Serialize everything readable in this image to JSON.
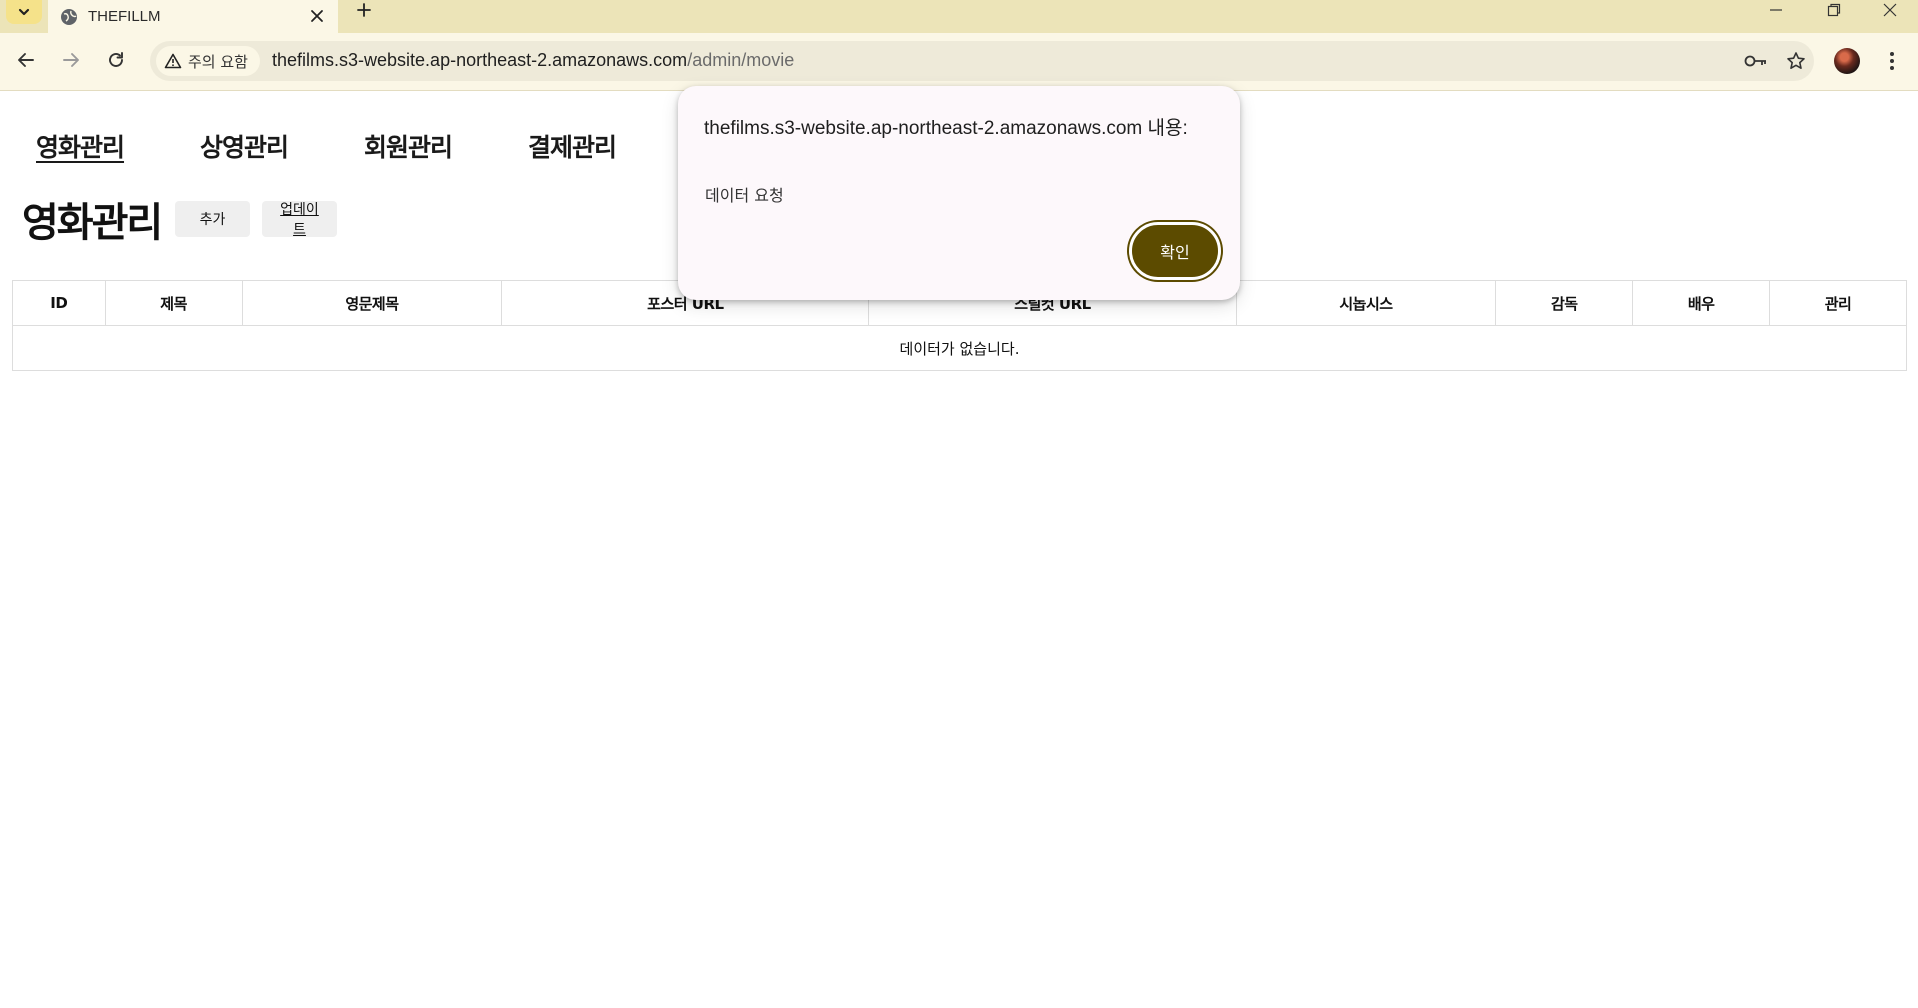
{
  "browser": {
    "tab_title": "THEFILLM",
    "security_label": "주의 요함",
    "url_host": "thefilms.s3-website.ap-northeast-2.amazonaws.com",
    "url_path": "/admin/movie"
  },
  "nav": {
    "items": [
      {
        "label": "영화관리"
      },
      {
        "label": "상영관리"
      },
      {
        "label": "회원관리"
      },
      {
        "label": "결제관리"
      }
    ]
  },
  "page": {
    "title": "영화관리",
    "add_label": "추가",
    "update_label": "업데이트"
  },
  "table": {
    "columns": [
      "ID",
      "제목",
      "영문제목",
      "포스터 URL",
      "스틸컷 URL",
      "시놉시스",
      "감독",
      "배우",
      "관리"
    ],
    "empty_message": "데이터가 없습니다."
  },
  "dialog": {
    "title": "thefilms.s3-website.ap-northeast-2.amazonaws.com 내용:",
    "message": "데이터 요청",
    "ok_label": "확인"
  },
  "colors": {
    "tabstrip": "#ece4b8",
    "toolbar": "#fbf7e6",
    "dialog_button": "#5c4b00"
  }
}
